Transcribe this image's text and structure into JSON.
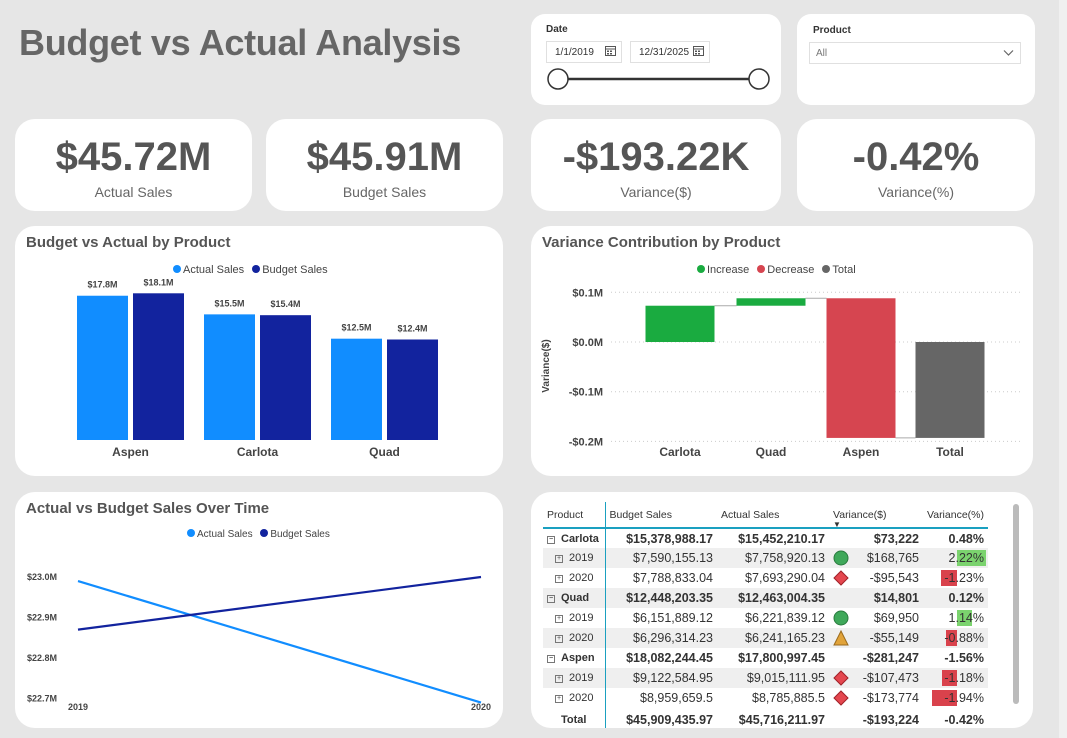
{
  "page_title": "Budget vs Actual Analysis",
  "date_slicer": {
    "label": "Date",
    "start": "1/1/2019",
    "end": "12/31/2025"
  },
  "product_slicer": {
    "label": "Product",
    "value": "All"
  },
  "kpis": [
    {
      "value": "$45.72M",
      "label": "Actual Sales"
    },
    {
      "value": "$45.91M",
      "label": "Budget Sales"
    },
    {
      "value": "-$193.22K",
      "label": "Variance($)"
    },
    {
      "value": "-0.42%",
      "label": "Variance(%)"
    }
  ],
  "colors": {
    "actual": "#118dff",
    "budget": "#12239e",
    "increase": "#1aab40",
    "decrease": "#d64550",
    "total": "#666666"
  },
  "bar_chart": {
    "title": "Budget vs Actual by Product",
    "legend": [
      "Actual Sales",
      "Budget Sales"
    ]
  },
  "waterfall": {
    "title": "Variance Contribution by Product",
    "legend": [
      "Increase",
      "Decrease",
      "Total"
    ],
    "ylabel": "Variance($)",
    "yticks": [
      "$0.1M",
      "$0.0M",
      "-$0.1M",
      "-$0.2M"
    ]
  },
  "line_chart": {
    "title": "Actual vs Budget Sales Over Time",
    "legend": [
      "Actual Sales",
      "Budget Sales"
    ],
    "yticks": [
      "$23.0M",
      "$22.9M",
      "$22.8M",
      "$22.7M"
    ],
    "xticks": [
      "2019",
      "2020"
    ]
  },
  "chart_data": [
    {
      "type": "bar",
      "title": "Budget vs Actual by Product",
      "categories": [
        "Aspen",
        "Carlota",
        "Quad"
      ],
      "series": [
        {
          "name": "Actual Sales",
          "values": [
            17.8,
            15.5,
            12.5
          ],
          "labels": [
            "$17.8M",
            "$15.5M",
            "$12.5M"
          ]
        },
        {
          "name": "Budget Sales",
          "values": [
            18.1,
            15.4,
            12.4
          ],
          "labels": [
            "$18.1M",
            "$15.4M",
            "$12.4M"
          ]
        }
      ],
      "ylim": [
        0,
        19
      ]
    },
    {
      "type": "bar",
      "title": "Variance Contribution by Product",
      "categories": [
        "Carlota",
        "Quad",
        "Aspen",
        "Total"
      ],
      "values": [
        0.073,
        0.015,
        -0.281,
        -0.193
      ],
      "kinds": [
        "increase",
        "increase",
        "decrease",
        "total"
      ],
      "ylabel": "Variance($)",
      "ylim": [
        -0.2,
        0.1
      ]
    },
    {
      "type": "line",
      "title": "Actual vs Budget Sales Over Time",
      "x": [
        "2019",
        "2020"
      ],
      "series": [
        {
          "name": "Actual Sales",
          "values": [
            22.99,
            22.69
          ]
        },
        {
          "name": "Budget Sales",
          "values": [
            22.87,
            23.0
          ]
        }
      ],
      "ylim": [
        22.7,
        23.0
      ]
    }
  ],
  "matrix": {
    "headers": [
      "Product",
      "Budget Sales",
      "Actual Sales",
      "Variance($)",
      "Variance(%)"
    ],
    "rows": [
      {
        "level": 0,
        "label": "Carlota",
        "budget": "$15,378,988.17",
        "actual": "$15,452,210.17",
        "var": "$73,222",
        "pct": "0.48%",
        "pct_value": 0.48
      },
      {
        "level": 1,
        "label": "2019",
        "budget": "$7,590,155.13",
        "actual": "$7,758,920.13",
        "var": "$168,765",
        "pct": "2.22%",
        "pct_value": 2.22,
        "icon": "circle"
      },
      {
        "level": 1,
        "label": "2020",
        "budget": "$7,788,833.04",
        "actual": "$7,693,290.04",
        "var": "-$95,543",
        "pct": "-1.23%",
        "pct_value": -1.23,
        "icon": "diamond"
      },
      {
        "level": 0,
        "label": "Quad",
        "budget": "$12,448,203.35",
        "actual": "$12,463,004.35",
        "var": "$14,801",
        "pct": "0.12%",
        "pct_value": 0.12
      },
      {
        "level": 1,
        "label": "2019",
        "budget": "$6,151,889.12",
        "actual": "$6,221,839.12",
        "var": "$69,950",
        "pct": "1.14%",
        "pct_value": 1.14,
        "icon": "circle"
      },
      {
        "level": 1,
        "label": "2020",
        "budget": "$6,296,314.23",
        "actual": "$6,241,165.23",
        "var": "-$55,149",
        "pct": "-0.88%",
        "pct_value": -0.88,
        "icon": "triangle"
      },
      {
        "level": 0,
        "label": "Aspen",
        "budget": "$18,082,244.45",
        "actual": "$17,800,997.45",
        "var": "-$281,247",
        "pct": "-1.56%",
        "pct_value": -1.56
      },
      {
        "level": 1,
        "label": "2019",
        "budget": "$9,122,584.95",
        "actual": "$9,015,111.95",
        "var": "-$107,473",
        "pct": "-1.18%",
        "pct_value": -1.18,
        "icon": "diamond"
      },
      {
        "level": 1,
        "label": "2020",
        "budget": "$8,959,659.5",
        "actual": "$8,785,885.5",
        "var": "-$173,774",
        "pct": "-1.94%",
        "pct_value": -1.94,
        "icon": "diamond"
      }
    ],
    "total": {
      "label": "Total",
      "budget": "$45,909,435.97",
      "actual": "$45,716,211.97",
      "var": "-$193,224",
      "pct": "-0.42%"
    }
  }
}
